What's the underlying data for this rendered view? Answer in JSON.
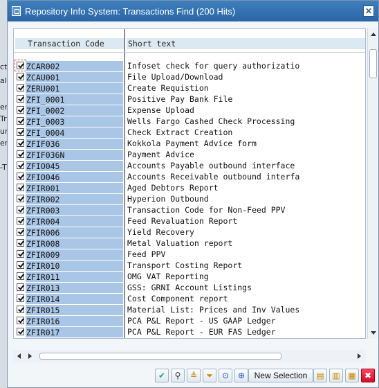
{
  "dialog": {
    "title": "Repository Info System: Transactions Find (200 Hits)"
  },
  "bg_fragments": [
    "ctic",
    "al",
    "en",
    "Tra",
    "uni",
    "er",
    "-T"
  ],
  "table": {
    "headers": [
      "Transaction Code",
      "Short text"
    ],
    "rows": [
      {
        "code": "ZCAR002",
        "text": "Infoset check for query authorizatio"
      },
      {
        "code": "ZCAU001",
        "text": "File Upload/Download"
      },
      {
        "code": "ZERU001",
        "text": "Create Requistion"
      },
      {
        "code": "ZFI_0001",
        "text": "Positive Pay Bank File"
      },
      {
        "code": "ZFI_0002",
        "text": "Expense Upload"
      },
      {
        "code": "ZFI_0003",
        "text": "Wells Fargo Cashed Check Processing"
      },
      {
        "code": "ZFI_0004",
        "text": "Check Extract Creation"
      },
      {
        "code": "ZFIF036",
        "text": "Kokkola Payment Advice form"
      },
      {
        "code": "ZFIF036N",
        "text": "Payment Advice"
      },
      {
        "code": "ZFIO045",
        "text": "Accounts Payable outbound interface"
      },
      {
        "code": "ZFIO046",
        "text": "Accounts Receivable outbound interfa"
      },
      {
        "code": "ZFIR001",
        "text": "Aged Debtors Report"
      },
      {
        "code": "ZFIR002",
        "text": "Hyperion Outbound"
      },
      {
        "code": "ZFIR003",
        "text": "Transaction Code for Non-Feed PPV"
      },
      {
        "code": "ZFIR004",
        "text": "Feed Revaluation Report"
      },
      {
        "code": "ZFIR006",
        "text": "Yield Recovery"
      },
      {
        "code": "ZFIR008",
        "text": "Metal Valuation report"
      },
      {
        "code": "ZFIR009",
        "text": "Feed PPV"
      },
      {
        "code": "ZFIR010",
        "text": "Transport Costing Report"
      },
      {
        "code": "ZFIR011",
        "text": "OMG VAT Reporting"
      },
      {
        "code": "ZFIR013",
        "text": "GSS: GRNI Account Listings"
      },
      {
        "code": "ZFIR014",
        "text": "Cost Component report"
      },
      {
        "code": "ZFIR015",
        "text": "Material List: Prices and Inv Values"
      },
      {
        "code": "ZFIR016",
        "text": "PCA P&L Report - US GAAP Ledger"
      },
      {
        "code": "ZFIR017",
        "text": "PCA P&L Report - EUR FAS Ledger"
      }
    ]
  },
  "toolbar": {
    "new_selection_label": "New Selection",
    "icons": [
      "checkmark-icon",
      "find-icon",
      "sort-ascending-icon",
      "filter-icon",
      "binoculars-icon",
      "find-next-icon",
      "select-all-icon",
      "deselect-all-icon",
      "details-icon",
      "cancel-icon"
    ]
  },
  "colors": {
    "titlebar": "#2a66a6",
    "selected_code_bg": "#a9c6e6",
    "header_bg": "#dde9f2"
  }
}
